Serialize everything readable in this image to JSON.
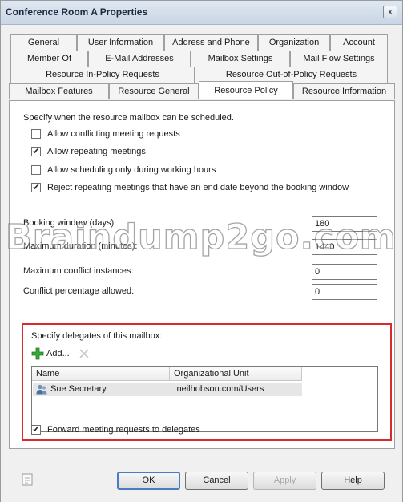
{
  "window": {
    "title": "Conference Room A Properties",
    "close_glyph": "x"
  },
  "tabs": {
    "row1": [
      "General",
      "User Information",
      "Address and Phone",
      "Organization",
      "Account"
    ],
    "row2": [
      "Member Of",
      "E-Mail Addresses",
      "Mailbox Settings",
      "Mail Flow Settings"
    ],
    "row3": [
      "Resource In-Policy Requests",
      "Resource Out-of-Policy Requests"
    ],
    "row4": [
      "Mailbox Features",
      "Resource General",
      "Resource Policy",
      "Resource Information"
    ],
    "active": "Resource Policy"
  },
  "scheduling": {
    "intro": "Specify when the resource mailbox can be scheduled.",
    "options": [
      {
        "label": "Allow conflicting meeting requests",
        "checked": false
      },
      {
        "label": "Allow repeating meetings",
        "checked": true
      },
      {
        "label": "Allow scheduling only during working hours",
        "checked": false
      },
      {
        "label": "Reject repeating meetings that have an end date beyond the booking window",
        "checked": true
      }
    ]
  },
  "fields": [
    {
      "label": "Booking window (days):",
      "value": "180"
    },
    {
      "label": "Maximum duration (minutes):",
      "value": "1440"
    },
    {
      "label": "Maximum conflict instances:",
      "value": "0"
    },
    {
      "label": "Conflict percentage allowed:",
      "value": "0"
    }
  ],
  "watermark": "Braindump2go.com",
  "delegates": {
    "title": "Specify delegates of this mailbox:",
    "add_label": "Add...",
    "columns": [
      "Name",
      "Organizational Unit"
    ],
    "rows": [
      {
        "name": "Sue Secretary",
        "ou": "neilhobson.com/Users"
      }
    ],
    "forward_label": "Forward meeting requests to delegates",
    "forward_checked": true
  },
  "buttons": {
    "ok": "OK",
    "cancel": "Cancel",
    "apply": "Apply",
    "help": "Help"
  },
  "colors": {
    "highlight_border": "#d92b2b",
    "add_icon": "#3aa83a"
  },
  "icons": {
    "add": "green-plus-icon",
    "remove": "red-x-icon",
    "user": "user-icon",
    "check": "checkmark-icon"
  }
}
